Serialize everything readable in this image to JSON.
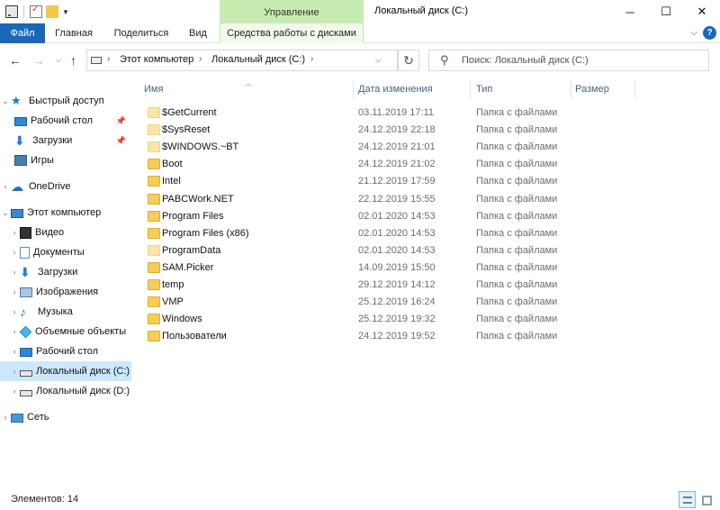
{
  "window": {
    "title": "Локальный диск (C:)",
    "context_tab_group": "Управление",
    "minimize": "─",
    "maximize": "☐",
    "close": "✕"
  },
  "ribbon": {
    "tabs": [
      "Файл",
      "Главная",
      "Поделиться",
      "Вид",
      "Средства работы с дисками"
    ],
    "expand_icon": "chevron-down-icon",
    "help": "?"
  },
  "address": {
    "crumbs": [
      "Этот компьютер",
      "Локальный диск (C:)"
    ],
    "separator": "›"
  },
  "search": {
    "placeholder": "Поиск: Локальный диск (C:)"
  },
  "nav_pane": {
    "items": [
      {
        "label": "Быстрый доступ",
        "icon": "star-icon",
        "pinned": false
      },
      {
        "label": "Рабочий стол",
        "icon": "desktop-icon",
        "pinned": true
      },
      {
        "label": "Загрузки",
        "icon": "download-icon",
        "pinned": true
      },
      {
        "label": "Игры",
        "icon": "games-icon",
        "pinned": false
      },
      {
        "label": "OneDrive",
        "icon": "cloud-icon",
        "pinned": false
      },
      {
        "label": "Этот компьютер",
        "icon": "computer-icon",
        "pinned": false
      },
      {
        "label": "Видео",
        "icon": "video-icon",
        "pinned": false
      },
      {
        "label": "Документы",
        "icon": "documents-icon",
        "pinned": false
      },
      {
        "label": "Загрузки",
        "icon": "download-icon",
        "pinned": false
      },
      {
        "label": "Изображения",
        "icon": "images-icon",
        "pinned": false
      },
      {
        "label": "Музыка",
        "icon": "music-icon",
        "pinned": false
      },
      {
        "label": "Объемные объекты",
        "icon": "3d-objects-icon",
        "pinned": false
      },
      {
        "label": "Рабочий стол",
        "icon": "desktop-icon",
        "pinned": false
      },
      {
        "label": "Локальный диск (C:)",
        "icon": "drive-icon",
        "pinned": false,
        "selected": true
      },
      {
        "label": "Локальный диск (D:)",
        "icon": "drive-icon",
        "pinned": false
      },
      {
        "label": "Сеть",
        "icon": "network-icon",
        "pinned": false
      }
    ]
  },
  "columns": [
    "Имя",
    "Дата изменения",
    "Тип",
    "Размер"
  ],
  "files": [
    {
      "name": "$GetCurrent",
      "date": "03.11.2019 17:11",
      "type": "Папка с файлами",
      "hidden": true
    },
    {
      "name": "$SysReset",
      "date": "24.12.2019 22:18",
      "type": "Папка с файлами",
      "hidden": true
    },
    {
      "name": "$WINDOWS.~BT",
      "date": "24.12.2019 21:01",
      "type": "Папка с файлами",
      "hidden": true
    },
    {
      "name": "Boot",
      "date": "24.12.2019 21:02",
      "type": "Папка с файлами",
      "hidden": false
    },
    {
      "name": "Intel",
      "date": "21.12.2019 17:59",
      "type": "Папка с файлами",
      "hidden": false
    },
    {
      "name": "PABCWork.NET",
      "date": "22.12.2019 15:55",
      "type": "Папка с файлами",
      "hidden": false
    },
    {
      "name": "Program Files",
      "date": "02.01.2020 14:53",
      "type": "Папка с файлами",
      "hidden": false
    },
    {
      "name": "Program Files (x86)",
      "date": "02.01.2020 14:53",
      "type": "Папка с файлами",
      "hidden": false
    },
    {
      "name": "ProgramData",
      "date": "02.01.2020 14:53",
      "type": "Папка с файлами",
      "hidden": true
    },
    {
      "name": "SAM.Picker",
      "date": "14.09.2019 15:50",
      "type": "Папка с файлами",
      "hidden": false
    },
    {
      "name": "temp",
      "date": "29.12.2019 14:12",
      "type": "Папка с файлами",
      "hidden": false
    },
    {
      "name": "VMP",
      "date": "25.12.2019 16:24",
      "type": "Папка с файлами",
      "hidden": false
    },
    {
      "name": "Windows",
      "date": "25.12.2019 19:32",
      "type": "Папка с файлами",
      "hidden": false
    },
    {
      "name": "Пользователи",
      "date": "24.12.2019 19:52",
      "type": "Папка с файлами",
      "hidden": false
    }
  ],
  "status": {
    "items_count": "Элементов: 14"
  }
}
